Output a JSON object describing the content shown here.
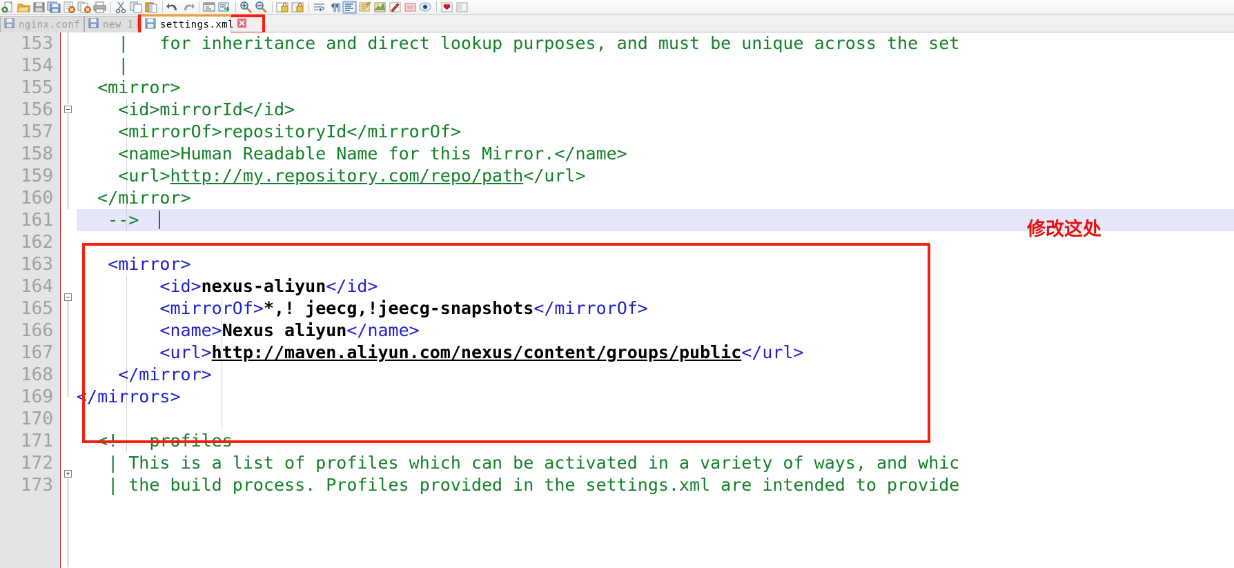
{
  "toolbar": {
    "buttons": [
      {
        "name": "new-file-icon",
        "label": "New"
      },
      {
        "name": "open-file-icon",
        "label": "Open"
      },
      {
        "name": "save-icon",
        "label": "Save"
      },
      {
        "name": "save-all-icon",
        "label": "Save All"
      },
      {
        "name": "close-file-icon",
        "label": "Close"
      },
      {
        "name": "close-all-icon",
        "label": "Close All"
      },
      {
        "name": "print-icon",
        "label": "Print"
      },
      {
        "name": "cut-icon",
        "label": "Cut"
      },
      {
        "name": "copy-icon",
        "label": "Copy"
      },
      {
        "name": "paste-icon",
        "label": "Paste"
      },
      {
        "name": "undo-icon",
        "label": "Undo"
      },
      {
        "name": "redo-icon",
        "label": "Redo"
      },
      {
        "name": "find-icon",
        "label": "Find"
      },
      {
        "name": "replace-icon",
        "label": "Replace"
      },
      {
        "name": "zoom-in-icon",
        "label": "Zoom In"
      },
      {
        "name": "zoom-out-icon",
        "label": "Zoom Out"
      },
      {
        "name": "sync-vertical-icon",
        "label": "Synchronize Vertical Scrolling"
      },
      {
        "name": "sync-horizontal-icon",
        "label": "Synchronize Horizontal Scrolling"
      },
      {
        "name": "word-wrap-icon",
        "label": "Word Wrap"
      },
      {
        "name": "show-all-chars-icon",
        "label": "Show All Characters"
      },
      {
        "name": "indent-guide-icon",
        "label": "Show Indent Guide"
      },
      {
        "name": "user-defined-dialog-icon",
        "label": "User Defined Dialogue"
      },
      {
        "name": "show-whitespace-icon",
        "label": "Show White Space"
      },
      {
        "name": "macro-record-icon",
        "label": "Start Recording"
      },
      {
        "name": "macro-stop-icon",
        "label": "Stop Recording"
      },
      {
        "name": "macro-play-icon",
        "label": "Play Recording"
      },
      {
        "name": "bookmark-icon",
        "label": "Bookmark"
      },
      {
        "name": "document-map-icon",
        "label": "Document Map"
      }
    ]
  },
  "tabs": [
    {
      "label": "nginx.conf",
      "active": false,
      "modified": false
    },
    {
      "label": "new 1",
      "active": false,
      "modified": false
    },
    {
      "label": "settings.xml",
      "active": true,
      "modified": false
    }
  ],
  "editor": {
    "first_line_number": 153,
    "current_line": 161,
    "line_numbers": [
      "153",
      "154",
      "155",
      "156",
      "157",
      "158",
      "159",
      "160",
      "161",
      "162",
      "163",
      "164",
      "165",
      "166",
      "167",
      "168",
      "169",
      "170",
      "171",
      "172",
      "173"
    ],
    "lines": [
      {
        "num": "153",
        "segments": [
          {
            "cls": "cm",
            "text": "    |   for inheritance and direct lookup purposes, and must be unique across the set"
          }
        ]
      },
      {
        "num": "154",
        "segments": [
          {
            "cls": "cm",
            "text": "    |"
          }
        ]
      },
      {
        "num": "155",
        "segments": [
          {
            "cls": "cm",
            "text": "  <mirror>"
          }
        ]
      },
      {
        "num": "156",
        "segments": [
          {
            "cls": "cm",
            "text": "    <id>mirrorId</id>"
          }
        ]
      },
      {
        "num": "157",
        "segments": [
          {
            "cls": "cm",
            "text": "    <mirrorOf>repositoryId</mirrorOf>"
          }
        ]
      },
      {
        "num": "158",
        "segments": [
          {
            "cls": "cm",
            "text": "    <name>Human Readable Name for this Mirror.</name>"
          }
        ]
      },
      {
        "num": "159",
        "segments": [
          {
            "cls": "cm",
            "text": "    <url>"
          },
          {
            "cls": "cm ul",
            "text": "http://my.repository.com/repo/path"
          },
          {
            "cls": "cm",
            "text": "</url>"
          }
        ]
      },
      {
        "num": "160",
        "segments": [
          {
            "cls": "cm",
            "text": "  </mirror>"
          }
        ]
      },
      {
        "num": "161",
        "segments": [
          {
            "cls": "cm",
            "text": "   -->"
          }
        ]
      },
      {
        "num": "162",
        "segments": []
      },
      {
        "num": "163",
        "segments": [
          {
            "cls": "tag",
            "text": "   <mirror>"
          }
        ]
      },
      {
        "num": "164",
        "segments": [
          {
            "cls": "tag",
            "text": "        <id>"
          },
          {
            "cls": "txt",
            "text": "nexus-aliyun"
          },
          {
            "cls": "tag",
            "text": "</id>"
          }
        ]
      },
      {
        "num": "165",
        "segments": [
          {
            "cls": "tag",
            "text": "        <mirrorOf>"
          },
          {
            "cls": "txt",
            "text": "*,! jeecg,!jeecg-snapshots"
          },
          {
            "cls": "tag",
            "text": "</mirrorOf>"
          }
        ]
      },
      {
        "num": "166",
        "segments": [
          {
            "cls": "tag",
            "text": "        <name>"
          },
          {
            "cls": "txt",
            "text": "Nexus aliyun"
          },
          {
            "cls": "tag",
            "text": "</name>"
          }
        ]
      },
      {
        "num": "167",
        "segments": [
          {
            "cls": "tag",
            "text": "        <url>"
          },
          {
            "cls": "txt ul",
            "text": "http://maven.aliyun.com/nexus/content/groups/public"
          },
          {
            "cls": "tag",
            "text": "</url>"
          }
        ]
      },
      {
        "num": "168",
        "segments": [
          {
            "cls": "tag",
            "text": "    </mirror>"
          }
        ]
      },
      {
        "num": "169",
        "segments": [
          {
            "cls": "tag",
            "text": "</mirrors>"
          }
        ]
      },
      {
        "num": "170",
        "segments": []
      },
      {
        "num": "171",
        "segments": [
          {
            "cls": "cm",
            "text": "  <!-- profiles"
          }
        ]
      },
      {
        "num": "172",
        "segments": [
          {
            "cls": "cm",
            "text": "   | This is a list of profiles which can be activated in a variety of ways, and whic"
          }
        ]
      },
      {
        "num": "173",
        "segments": [
          {
            "cls": "cm",
            "text": "   | the build process. Profiles provided in the settings.xml are intended to provide"
          }
        ]
      }
    ]
  },
  "annotations": {
    "note_text": "修改这处",
    "note_color": "#e8100a",
    "box_color": "#fa1e0e"
  },
  "colors": {
    "comment_green": "#128128",
    "tag_blue": "#2222cc",
    "content_black": "#000000",
    "current_line_bg": "#e6e6fa",
    "gutter_bg": "#e4e4e4",
    "line_number_fg": "#a0a0a0",
    "active_tab_top": "#f0a030"
  }
}
